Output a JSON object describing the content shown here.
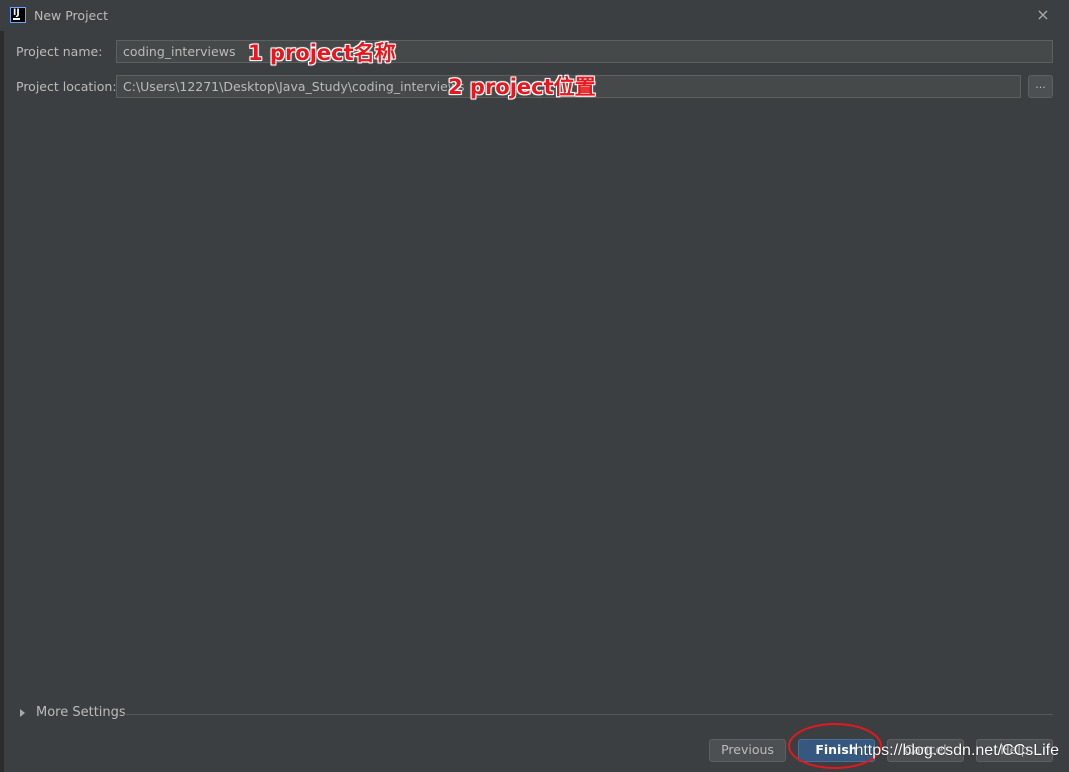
{
  "window": {
    "title": "New Project",
    "close_glyph": "×"
  },
  "form": {
    "project_name": {
      "label": "Project name:",
      "value": "coding_interviews"
    },
    "project_location": {
      "label": "Project location:",
      "value": "C:\\Users\\12271\\Desktop\\Java_Study\\coding_interviews",
      "browse_label": "..."
    }
  },
  "annotations": {
    "name_note": "1 project名称",
    "location_note": "2 project位置"
  },
  "more_settings": {
    "label": "More Settings"
  },
  "buttons": {
    "previous": "Previous",
    "finish": "Finish",
    "cancel": "Cancel",
    "help": "Help"
  },
  "watermark": "https://blog.csdn.net/CCsLife",
  "colors": {
    "background": "#3c3f41",
    "annotation": "#e8171d",
    "primary_button": "#365880"
  },
  "icons": {
    "app": "intellij-idea-icon",
    "close": "close-icon",
    "expand": "triangle-right-icon"
  }
}
